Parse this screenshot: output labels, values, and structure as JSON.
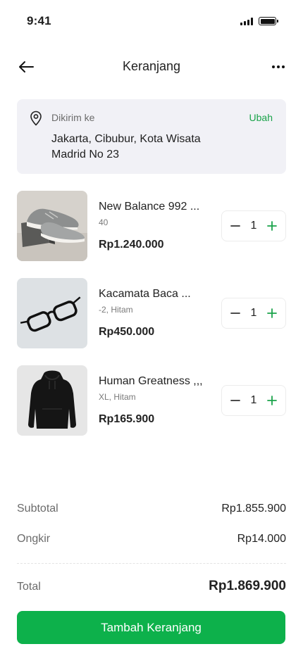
{
  "status_bar": {
    "time": "9:41"
  },
  "header": {
    "title": "Keranjang"
  },
  "address": {
    "label": "Dikirim ke",
    "change_label": "Ubah",
    "value": "Jakarta, Cibubur, Kota Wisata Madrid No 23"
  },
  "cart": {
    "items": [
      {
        "name": "New Balance 992 ...",
        "variant": "40",
        "price": "Rp1.240.000",
        "quantity": "1",
        "image": "sneakers-photo"
      },
      {
        "name": "Kacamata Baca ...",
        "variant": "-2, Hitam",
        "price": "Rp450.000",
        "quantity": "1",
        "image": "eyeglasses-photo"
      },
      {
        "name": "Human Greatness ,,,",
        "variant": "XL, Hitam",
        "price": "Rp165.900",
        "quantity": "1",
        "image": "black-hoodie-photo"
      }
    ]
  },
  "summary": {
    "subtotal_label": "Subtotal",
    "subtotal_value": "Rp1.855.900",
    "shipping_label": "Ongkir",
    "shipping_value": "Rp14.000",
    "total_label": "Total",
    "total_value": "Rp1.869.900"
  },
  "cta": {
    "label": "Tambah Keranjang"
  },
  "colors": {
    "accent": "#0db14b",
    "accent_text": "#1aa34a",
    "card_bg": "#f1f1f6"
  }
}
